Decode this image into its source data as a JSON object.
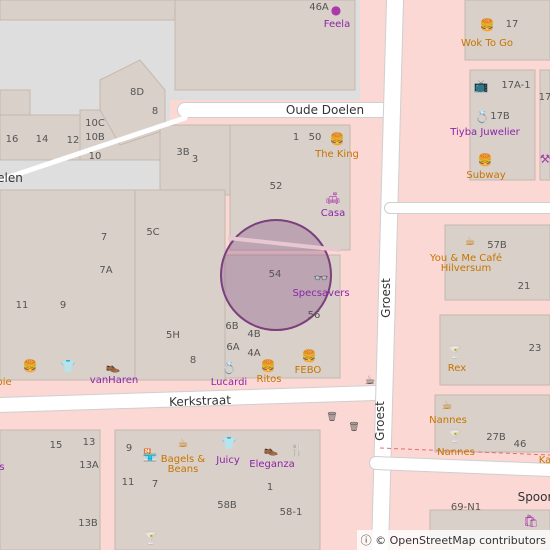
{
  "streets": {
    "oude_doelen": "Oude Doelen",
    "kerkstraat": "Kerkstraat",
    "groest_upper": "Groest",
    "groest_lower": "Groest",
    "elen": "elen",
    "spoor": "Spoor"
  },
  "house_numbers": [
    {
      "id": "n46a",
      "text": "46A"
    },
    {
      "id": "n17",
      "text": "17"
    },
    {
      "id": "n8d",
      "text": "8D"
    },
    {
      "id": "n8",
      "text": "8"
    },
    {
      "id": "n16",
      "text": "16"
    },
    {
      "id": "n14",
      "text": "14"
    },
    {
      "id": "n12",
      "text": "12"
    },
    {
      "id": "n10c",
      "text": "10C"
    },
    {
      "id": "n10b",
      "text": "10B"
    },
    {
      "id": "n10",
      "text": "10"
    },
    {
      "id": "n3b",
      "text": "3B"
    },
    {
      "id": "n3",
      "text": "3"
    },
    {
      "id": "n1",
      "text": "1"
    },
    {
      "id": "n50",
      "text": "50"
    },
    {
      "id": "n52",
      "text": "52"
    },
    {
      "id": "n17a1",
      "text": "17A-1"
    },
    {
      "id": "n17b",
      "text": "17B"
    },
    {
      "id": "n17r",
      "text": "17"
    },
    {
      "id": "n7",
      "text": "7"
    },
    {
      "id": "n5c",
      "text": "5C"
    },
    {
      "id": "n7a",
      "text": "7A"
    },
    {
      "id": "n54",
      "text": "54"
    },
    {
      "id": "n57b",
      "text": "57B"
    },
    {
      "id": "n21",
      "text": "21"
    },
    {
      "id": "n11",
      "text": "11"
    },
    {
      "id": "n9",
      "text": "9"
    },
    {
      "id": "n5h",
      "text": "5H"
    },
    {
      "id": "n6b",
      "text": "6B"
    },
    {
      "id": "n4b",
      "text": "4B"
    },
    {
      "id": "n56",
      "text": "56"
    },
    {
      "id": "n23",
      "text": "23"
    },
    {
      "id": "n6a",
      "text": "6A"
    },
    {
      "id": "n4a",
      "text": "4A"
    },
    {
      "id": "n8b",
      "text": "8"
    },
    {
      "id": "n15",
      "text": "15"
    },
    {
      "id": "n13",
      "text": "13"
    },
    {
      "id": "n9b",
      "text": "9"
    },
    {
      "id": "n27b",
      "text": "27B"
    },
    {
      "id": "n46",
      "text": "46"
    },
    {
      "id": "n13a",
      "text": "13A"
    },
    {
      "id": "n11b",
      "text": "11"
    },
    {
      "id": "n7b",
      "text": "7"
    },
    {
      "id": "n1b",
      "text": "1"
    },
    {
      "id": "n58b",
      "text": "58B"
    },
    {
      "id": "n581",
      "text": "58-1"
    },
    {
      "id": "n13b",
      "text": "13B"
    },
    {
      "id": "n69n1",
      "text": "69-N1"
    }
  ],
  "pois": [
    {
      "id": "feela",
      "text": "Feela",
      "kind": "shop"
    },
    {
      "id": "woktogo",
      "text": "Wok To Go",
      "kind": "food"
    },
    {
      "id": "theking",
      "text": "The King",
      "kind": "food"
    },
    {
      "id": "tiyba",
      "text": "Tiyba Juwelier",
      "kind": "shop"
    },
    {
      "id": "subway",
      "text": "Subway",
      "kind": "food"
    },
    {
      "id": "casa",
      "text": "Casa",
      "kind": "shop"
    },
    {
      "id": "youme",
      "text": "You & Me Café Hilversum",
      "kind": "food"
    },
    {
      "id": "specsavers",
      "text": "Specsavers",
      "kind": "shop"
    },
    {
      "id": "rex",
      "text": "Rex",
      "kind": "food"
    },
    {
      "id": "vanharen",
      "text": "vanHaren",
      "kind": "shop"
    },
    {
      "id": "lucardi",
      "text": "Lucardi",
      "kind": "shop"
    },
    {
      "id": "ritos",
      "text": "Ritos",
      "kind": "food"
    },
    {
      "id": "febo",
      "text": "FEBO",
      "kind": "food"
    },
    {
      "id": "nannes1",
      "text": "Nannes",
      "kind": "food"
    },
    {
      "id": "nannes2",
      "text": "Nannes",
      "kind": "food"
    },
    {
      "id": "bagels",
      "text": "Bagels & Beans",
      "kind": "food"
    },
    {
      "id": "juicy",
      "text": "Juicy",
      "kind": "shop"
    },
    {
      "id": "eleganza",
      "text": "Eleganza",
      "kind": "shop"
    },
    {
      "id": "pie",
      "text": "pie",
      "kind": "food"
    },
    {
      "id": "s_left",
      "text": "s",
      "kind": "shop"
    },
    {
      "id": "k_right",
      "text": "Ka",
      "kind": "food"
    }
  ],
  "attribution": "© OpenStreetMap contributors",
  "colors": {
    "pedestrian": "#fddad6",
    "building": "#d9d0c9",
    "land": "#e0dfdf",
    "road": "#ffffff",
    "poi_shop": "#ac39ac",
    "poi_food": "#c77400",
    "circle": "#7b3f7d"
  }
}
